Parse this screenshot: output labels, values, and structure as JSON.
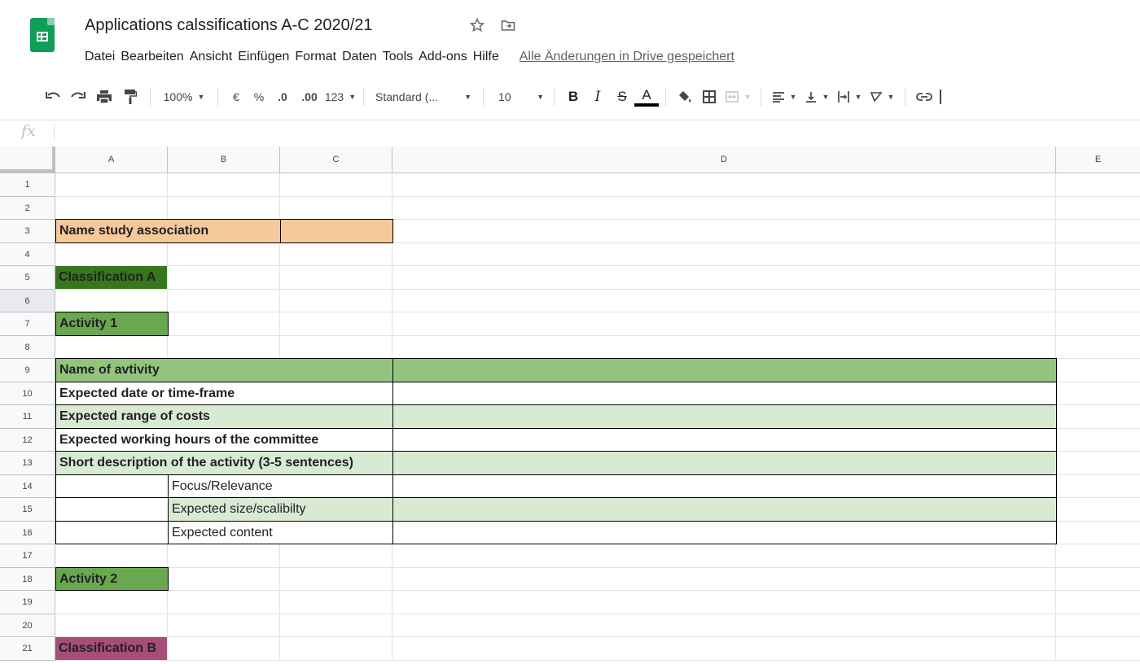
{
  "document": {
    "title": "Applications calssifications A-C 2020/21",
    "star_icon": "star-icon",
    "move_icon": "folder-move-icon"
  },
  "menu": [
    "Datei",
    "Bearbeiten",
    "Ansicht",
    "Einfügen",
    "Format",
    "Daten",
    "Tools",
    "Add-ons",
    "Hilfe"
  ],
  "save_status": "Alle Änderungen in Drive gespeichert",
  "toolbar": {
    "zoom": "100%",
    "currency": "€",
    "percent": "%",
    "dec_less": ".0",
    "dec_more": ".00",
    "more_formats": "123",
    "font": "Standard (...",
    "font_size": "10",
    "bold": "B",
    "italic": "I",
    "strike": "S",
    "text_color": "A"
  },
  "formula": {
    "fx": "fx",
    "value": ""
  },
  "columns": [
    "A",
    "B",
    "C",
    "D",
    "E"
  ],
  "rows": [
    "1",
    "2",
    "3",
    "4",
    "5",
    "6",
    "7",
    "8",
    "9",
    "10",
    "11",
    "12",
    "13",
    "14",
    "15",
    "16",
    "17",
    "18",
    "19",
    "20",
    "21"
  ],
  "cells": {
    "r3": "Name study association",
    "r5": "Classification A",
    "r7": "Activity 1",
    "r9": "Name of avtivity",
    "r10": "Expected date or time-frame",
    "r11": "Expected range of costs",
    "r12": "Expected working hours of the committee",
    "r13": "Short description of the activity (3-5 sentences)",
    "r14": "Focus/Relevance",
    "r15": "Expected size/scalibilty",
    "r16": "Expected content",
    "r18": "Activity 2",
    "r21": "Classification B"
  },
  "colors": {
    "orange": "#f6c89a",
    "dark_green": "#38761d",
    "mid_green": "#6aa84f",
    "light_green": "#93c47d",
    "pale_green": "#d9ead3",
    "purple": "#a64d79",
    "sheets_green": "#0f9d58"
  }
}
